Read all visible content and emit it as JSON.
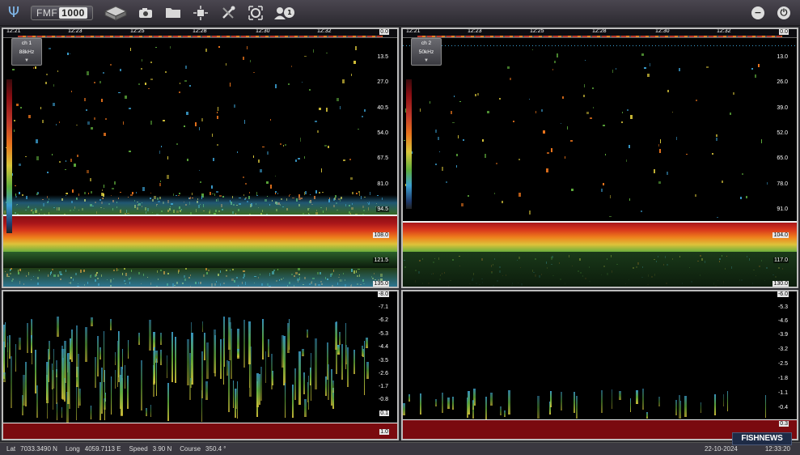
{
  "toolbar": {
    "brand_prefix": "FMF",
    "brand_number": "1000",
    "user_badge": "1",
    "minimize_glyph": "−",
    "power_glyph": "⏻"
  },
  "channels": [
    {
      "tag_label": "ch 1",
      "tag_freq": "88kHz",
      "times": [
        "12:21",
        "12:23",
        "12:25",
        "12:28",
        "12:30",
        "12:32"
      ],
      "depth_scale": [
        "0.0",
        "13.5",
        "27.0",
        "40.5",
        "54.0",
        "67.5",
        "81.0",
        "94.5",
        "108.0",
        "121.5",
        "135.0"
      ],
      "zoom_scale": [
        "-8.0",
        "-7.1",
        "-6.2",
        "-5.3",
        "-4.4",
        "-3.5",
        "-2.6",
        "-1.7",
        "-0.8",
        "0.1",
        "1.0"
      ]
    },
    {
      "tag_label": "ch 2",
      "tag_freq": "50kHz",
      "times": [
        "12:21",
        "12:23",
        "12:25",
        "12:28",
        "12:30",
        "12:32"
      ],
      "depth_scale": [
        "0.0",
        "13.0",
        "26.0",
        "39.0",
        "52.0",
        "65.0",
        "78.0",
        "91.0",
        "104.0",
        "117.0",
        "130.0"
      ],
      "zoom_scale": [
        "-6.0",
        "-5.3",
        "-4.6",
        "-3.9",
        "-3.2",
        "-2.5",
        "-1.8",
        "-1.1",
        "-0.4",
        "0.3"
      ]
    }
  ],
  "status": {
    "lat_label": "Lat",
    "lat_value": "7033.3490 N",
    "long_label": "Long",
    "long_value": "4059.7113 E",
    "speed_label": "Speed",
    "speed_value": "3.90 N",
    "course_label": "Course",
    "course_value": "350.4 °",
    "date": "22-10-2024",
    "time": "12:33:20"
  },
  "watermark": {
    "part1": "FISH",
    "part2": "NEWS"
  },
  "colors": {
    "bottom_red": "#7a0a0f",
    "echo_orange": "#e8731c",
    "echo_yellow": "#d9c63a",
    "echo_green": "#5fae3c",
    "echo_cyan": "#3b9fd0"
  }
}
